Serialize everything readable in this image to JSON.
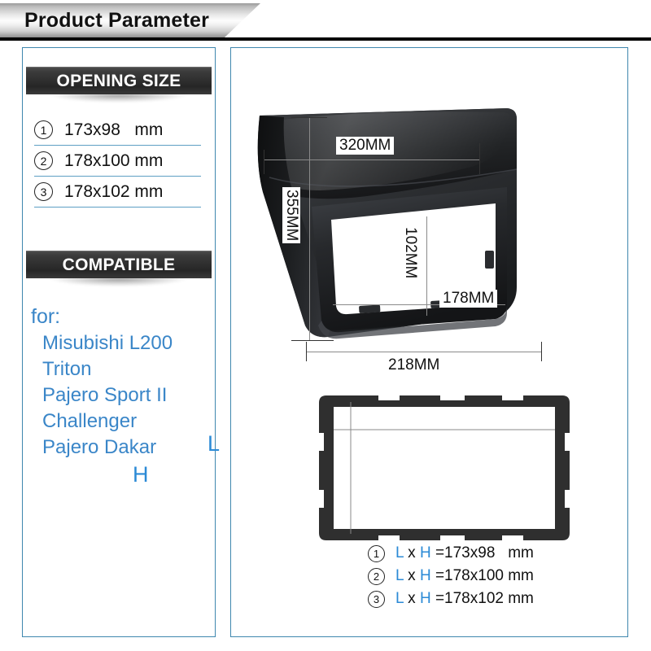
{
  "header": {
    "title": "Product Parameter"
  },
  "sections": {
    "opening_size": {
      "heading": "OPENING SIZE",
      "rows": [
        {
          "index": "1",
          "value": "173x98   mm"
        },
        {
          "index": "2",
          "value": "178x100 mm"
        },
        {
          "index": "3",
          "value": "178x102 mm"
        }
      ]
    },
    "compatible": {
      "heading": "COMPATIBLE",
      "for_label": "for:",
      "vehicles": [
        "Misubishi L200",
        "Triton",
        "Pajero Sport II",
        "Challenger",
        "Pajero Dakar"
      ]
    }
  },
  "figure_main": {
    "dimensions": {
      "top_width": "320MM",
      "left_height": "355MM",
      "inner_height": "102MM",
      "inner_width": "178MM",
      "bottom_width": "218MM"
    }
  },
  "figure_lower": {
    "label_length": "L",
    "label_height": "H"
  },
  "legend": {
    "rows": [
      {
        "index": "1",
        "l": "L",
        "x": " x ",
        "h": "H",
        "eq": " =173x98   mm"
      },
      {
        "index": "2",
        "l": "L",
        "x": " x ",
        "h": "H",
        "eq": " =178x100 mm"
      },
      {
        "index": "3",
        "l": "L",
        "x": " x ",
        "h": "H",
        "eq": " =178x102 mm"
      }
    ]
  },
  "colors": {
    "panel_border": "#3f87ae",
    "accent_blue": "#3a86c8",
    "label_blue": "#2b8ad6",
    "product_black": "#2f2f2f"
  }
}
